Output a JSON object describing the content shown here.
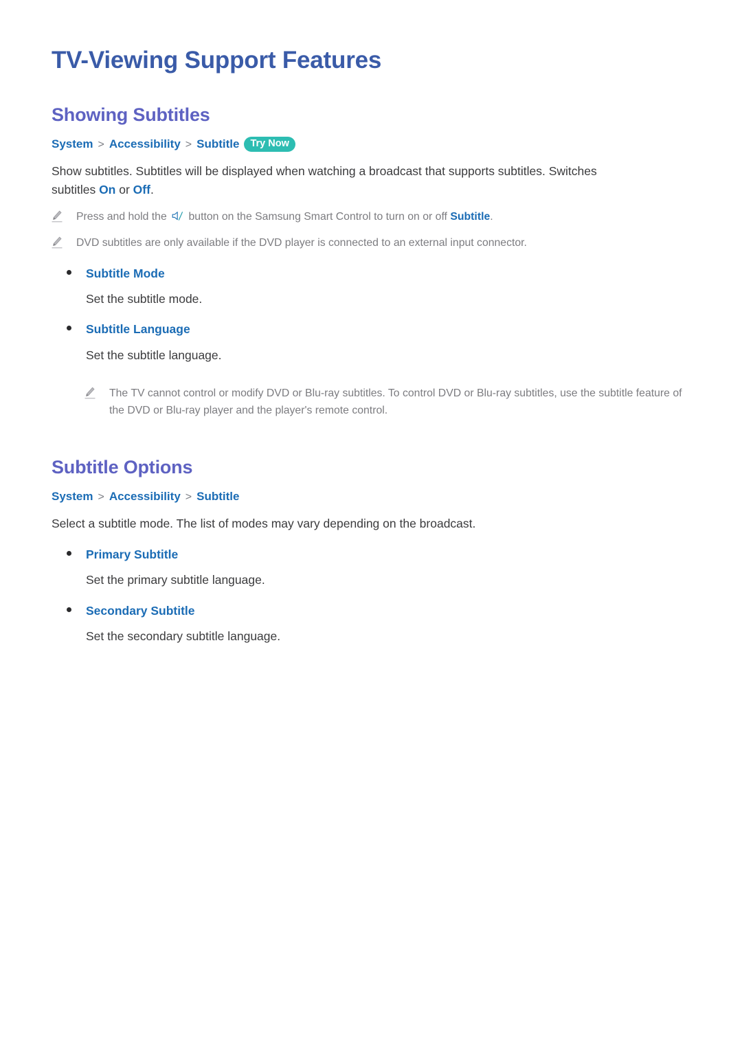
{
  "document": {
    "title": "TV-Viewing Support Features"
  },
  "sections": [
    {
      "heading": "Showing Subtitles",
      "breadcrumb": {
        "items": [
          "System",
          "Accessibility",
          "Subtitle"
        ],
        "separator": ">",
        "badge": "Try Now"
      },
      "intro": {
        "part1": "Show subtitles. Subtitles will be displayed when watching a broadcast that supports subtitles. Switches subtitles ",
        "kw1": "On",
        "part2": " or ",
        "kw2": "Off",
        "part3": "."
      },
      "notes": [
        {
          "icon": "pencil-icon",
          "inline_icon": "mute-button-icon",
          "text_before": "Press and hold the ",
          "text_middle": " button on the Samsung Smart Control to turn on or off ",
          "keyword": "Subtitle",
          "text_after": "."
        },
        {
          "icon": "pencil-icon",
          "text": "DVD subtitles are only available if the DVD player is connected to an external input connector."
        }
      ],
      "bullets": [
        {
          "label": "Subtitle Mode",
          "desc": "Set the subtitle mode."
        },
        {
          "label": "Subtitle Language",
          "desc": "Set the subtitle language."
        }
      ],
      "trailing_note": {
        "icon": "pencil-icon",
        "text": "The TV cannot control or modify DVD or Blu-ray subtitles. To control DVD or Blu-ray subtitles, use the subtitle feature of the DVD or Blu-ray player and the player's remote control."
      }
    },
    {
      "heading": "Subtitle Options",
      "breadcrumb": {
        "items": [
          "System",
          "Accessibility",
          "Subtitle"
        ],
        "separator": ">"
      },
      "intro": {
        "text": "Select a subtitle mode. The list of modes may vary depending on the broadcast."
      },
      "bullets": [
        {
          "label": "Primary Subtitle",
          "desc": "Set the primary subtitle language."
        },
        {
          "label": "Secondary Subtitle",
          "desc": "Set the secondary subtitle language."
        }
      ]
    }
  ],
  "colors": {
    "doc_title": "#3a5ba8",
    "section_heading": "#5e62c2",
    "link_blue": "#1b6cb5",
    "badge_teal": "#2dbdb2",
    "body_gray": "#3b3b3d",
    "note_gray": "#7c7c80",
    "background": "#ffffff"
  }
}
